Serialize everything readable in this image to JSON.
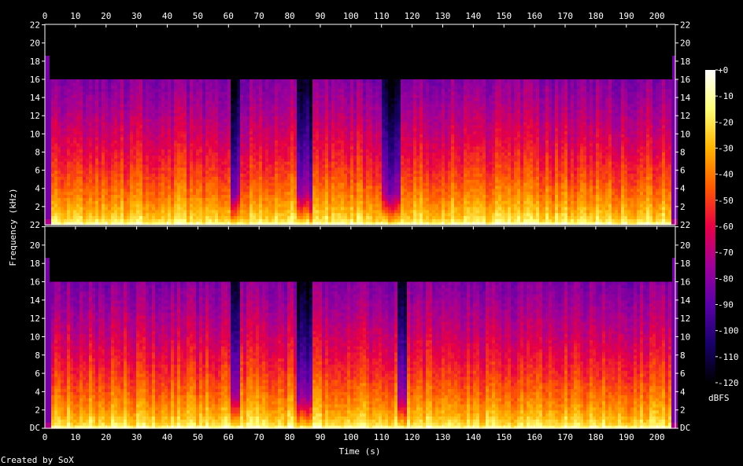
{
  "chart_data": {
    "type": "heatmap",
    "title": "",
    "xlabel": "Time (s)",
    "ylabel": "Frequency (kHz)",
    "xlim": [
      0,
      206
    ],
    "ylim": [
      0,
      22.05
    ],
    "x_ticks": [
      "0",
      "10",
      "20",
      "30",
      "40",
      "50",
      "60",
      "70",
      "80",
      "90",
      "100",
      "110",
      "120",
      "130",
      "140",
      "150",
      "160",
      "170",
      "180",
      "190",
      "200"
    ],
    "x_tick_values": [
      0,
      10,
      20,
      30,
      40,
      50,
      60,
      70,
      80,
      90,
      100,
      110,
      120,
      130,
      140,
      150,
      160,
      170,
      180,
      190,
      200
    ],
    "y_ticks": [
      "DC",
      "2",
      "4",
      "6",
      "8",
      "10",
      "12",
      "14",
      "16",
      "18",
      "20",
      "22"
    ],
    "y_tick_values": [
      0,
      2,
      4,
      6,
      8,
      10,
      12,
      14,
      16,
      18,
      20,
      22
    ],
    "channels": [
      {
        "name": "",
        "content_cutoff_khz": 16,
        "quiet_dips_s": [
          [
            61,
            64
          ],
          [
            82,
            87
          ],
          [
            110,
            116
          ]
        ]
      },
      {
        "name": "",
        "content_cutoff_khz": 16,
        "quiet_dips_s": [
          [
            61,
            64
          ],
          [
            82,
            87
          ],
          [
            115,
            118
          ]
        ]
      }
    ],
    "color_scale": {
      "label": "dBFS",
      "range": [
        -120,
        0
      ],
      "ticks": [
        "+0",
        "-10",
        "-20",
        "-30",
        "-40",
        "-50",
        "-60",
        "-70",
        "-80",
        "-90",
        "-100",
        "-110",
        "-120"
      ],
      "tick_values": [
        0,
        -10,
        -20,
        -30,
        -40,
        -50,
        -60,
        -70,
        -80,
        -90,
        -100,
        -110,
        -120
      ],
      "stops": [
        "#000000",
        "#18006a",
        "#5a00a8",
        "#a0009a",
        "#e80045",
        "#ff5a00",
        "#ffb400",
        "#ffff78",
        "#ffffff"
      ]
    },
    "grid": false,
    "legend": "right"
  },
  "footer": {
    "credit": "Created by SoX"
  }
}
